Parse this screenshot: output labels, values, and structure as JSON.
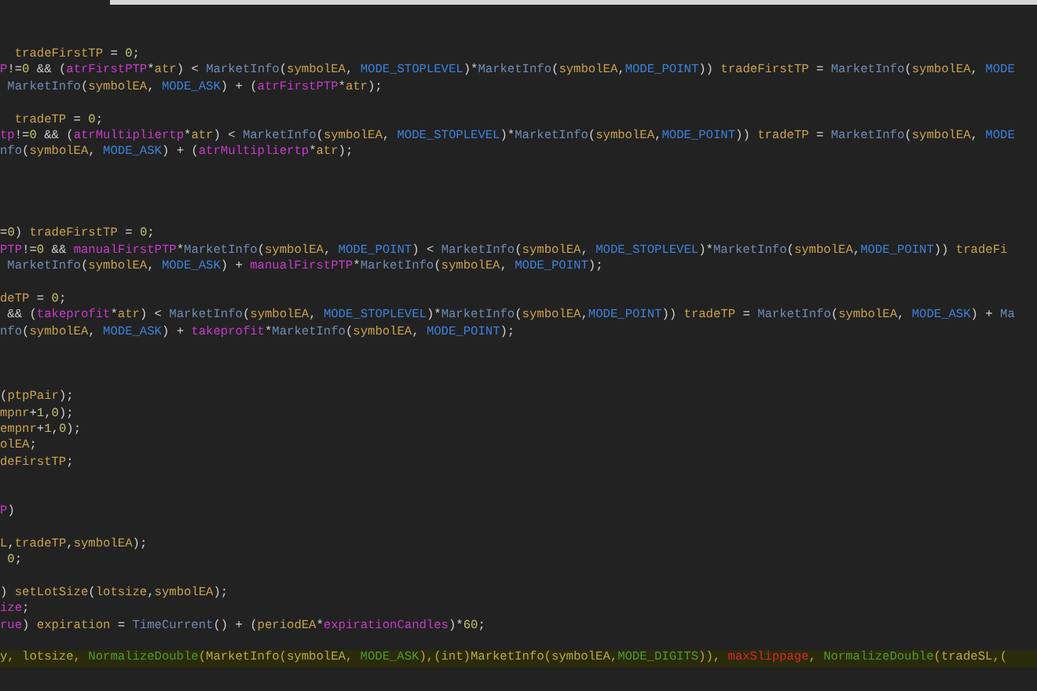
{
  "editor": {
    "lines": [
      {
        "kind": "code",
        "segments": [
          {
            "kind": "var",
            "text": "  tradeFirstTP"
          },
          {
            "kind": "op",
            "text": " = "
          },
          {
            "kind": "num",
            "text": "0"
          },
          {
            "kind": "op",
            "text": ";"
          }
        ]
      },
      {
        "kind": "code",
        "segments": [
          {
            "kind": "input",
            "text": "P"
          },
          {
            "kind": "op",
            "text": "!="
          },
          {
            "kind": "num",
            "text": "0"
          },
          {
            "kind": "op",
            "text": " && ("
          },
          {
            "kind": "input",
            "text": "atrFirstPTP"
          },
          {
            "kind": "op",
            "text": "*"
          },
          {
            "kind": "var",
            "text": "atr"
          },
          {
            "kind": "op",
            "text": ") < "
          },
          {
            "kind": "func",
            "text": "MarketInfo"
          },
          {
            "kind": "op",
            "text": "("
          },
          {
            "kind": "var",
            "text": "symbolEA"
          },
          {
            "kind": "op",
            "text": ", "
          },
          {
            "kind": "const",
            "text": "MODE_STOPLEVEL"
          },
          {
            "kind": "op",
            "text": ")*"
          },
          {
            "kind": "func",
            "text": "MarketInfo"
          },
          {
            "kind": "op",
            "text": "("
          },
          {
            "kind": "var",
            "text": "symbolEA"
          },
          {
            "kind": "op",
            "text": ","
          },
          {
            "kind": "const",
            "text": "MODE_POINT"
          },
          {
            "kind": "op",
            "text": ")) "
          },
          {
            "kind": "var",
            "text": "tradeFirstTP"
          },
          {
            "kind": "op",
            "text": " = "
          },
          {
            "kind": "func",
            "text": "MarketInfo"
          },
          {
            "kind": "op",
            "text": "("
          },
          {
            "kind": "var",
            "text": "symbolEA"
          },
          {
            "kind": "op",
            "text": ", "
          },
          {
            "kind": "const",
            "text": "MODE"
          }
        ]
      },
      {
        "kind": "code",
        "segments": [
          {
            "kind": "func",
            "text": " MarketInfo"
          },
          {
            "kind": "op",
            "text": "("
          },
          {
            "kind": "var",
            "text": "symbolEA"
          },
          {
            "kind": "op",
            "text": ", "
          },
          {
            "kind": "const",
            "text": "MODE_ASK"
          },
          {
            "kind": "op",
            "text": ") + ("
          },
          {
            "kind": "input",
            "text": "atrFirstPTP"
          },
          {
            "kind": "op",
            "text": "*"
          },
          {
            "kind": "var",
            "text": "atr"
          },
          {
            "kind": "op",
            "text": ");"
          }
        ]
      },
      {
        "kind": "blank"
      },
      {
        "kind": "code",
        "segments": [
          {
            "kind": "var",
            "text": "  tradeTP"
          },
          {
            "kind": "op",
            "text": " = "
          },
          {
            "kind": "num",
            "text": "0"
          },
          {
            "kind": "op",
            "text": ";"
          }
        ]
      },
      {
        "kind": "code",
        "segments": [
          {
            "kind": "input",
            "text": "tp"
          },
          {
            "kind": "op",
            "text": "!="
          },
          {
            "kind": "num",
            "text": "0"
          },
          {
            "kind": "op",
            "text": " && ("
          },
          {
            "kind": "input",
            "text": "atrMultipliertp"
          },
          {
            "kind": "op",
            "text": "*"
          },
          {
            "kind": "var",
            "text": "atr"
          },
          {
            "kind": "op",
            "text": ") < "
          },
          {
            "kind": "func",
            "text": "MarketInfo"
          },
          {
            "kind": "op",
            "text": "("
          },
          {
            "kind": "var",
            "text": "symbolEA"
          },
          {
            "kind": "op",
            "text": ", "
          },
          {
            "kind": "const",
            "text": "MODE_STOPLEVEL"
          },
          {
            "kind": "op",
            "text": ")*"
          },
          {
            "kind": "func",
            "text": "MarketInfo"
          },
          {
            "kind": "op",
            "text": "("
          },
          {
            "kind": "var",
            "text": "symbolEA"
          },
          {
            "kind": "op",
            "text": ","
          },
          {
            "kind": "const",
            "text": "MODE_POINT"
          },
          {
            "kind": "op",
            "text": ")) "
          },
          {
            "kind": "var",
            "text": "tradeTP"
          },
          {
            "kind": "op",
            "text": " = "
          },
          {
            "kind": "func",
            "text": "MarketInfo"
          },
          {
            "kind": "op",
            "text": "("
          },
          {
            "kind": "var",
            "text": "symbolEA"
          },
          {
            "kind": "op",
            "text": ", "
          },
          {
            "kind": "const",
            "text": "MODE"
          }
        ]
      },
      {
        "kind": "code",
        "segments": [
          {
            "kind": "func",
            "text": "nfo"
          },
          {
            "kind": "op",
            "text": "("
          },
          {
            "kind": "var",
            "text": "symbolEA"
          },
          {
            "kind": "op",
            "text": ", "
          },
          {
            "kind": "const",
            "text": "MODE_ASK"
          },
          {
            "kind": "op",
            "text": ") + ("
          },
          {
            "kind": "input",
            "text": "atrMultipliertp"
          },
          {
            "kind": "op",
            "text": "*"
          },
          {
            "kind": "var",
            "text": "atr"
          },
          {
            "kind": "op",
            "text": ");"
          }
        ]
      },
      {
        "kind": "blank"
      },
      {
        "kind": "blank"
      },
      {
        "kind": "blank"
      },
      {
        "kind": "blank"
      },
      {
        "kind": "code",
        "segments": [
          {
            "kind": "op",
            "text": "="
          },
          {
            "kind": "num",
            "text": "0"
          },
          {
            "kind": "op",
            "text": ") "
          },
          {
            "kind": "var",
            "text": "tradeFirstTP"
          },
          {
            "kind": "op",
            "text": " = "
          },
          {
            "kind": "num",
            "text": "0"
          },
          {
            "kind": "op",
            "text": ";"
          }
        ]
      },
      {
        "kind": "code",
        "segments": [
          {
            "kind": "input",
            "text": "PTP"
          },
          {
            "kind": "op",
            "text": "!="
          },
          {
            "kind": "num",
            "text": "0"
          },
          {
            "kind": "op",
            "text": " && "
          },
          {
            "kind": "input",
            "text": "manualFirstPTP"
          },
          {
            "kind": "op",
            "text": "*"
          },
          {
            "kind": "func",
            "text": "MarketInfo"
          },
          {
            "kind": "op",
            "text": "("
          },
          {
            "kind": "var",
            "text": "symbolEA"
          },
          {
            "kind": "op",
            "text": ", "
          },
          {
            "kind": "const",
            "text": "MODE_POINT"
          },
          {
            "kind": "op",
            "text": ") < "
          },
          {
            "kind": "func",
            "text": "MarketInfo"
          },
          {
            "kind": "op",
            "text": "("
          },
          {
            "kind": "var",
            "text": "symbolEA"
          },
          {
            "kind": "op",
            "text": ", "
          },
          {
            "kind": "const",
            "text": "MODE_STOPLEVEL"
          },
          {
            "kind": "op",
            "text": ")*"
          },
          {
            "kind": "func",
            "text": "MarketInfo"
          },
          {
            "kind": "op",
            "text": "("
          },
          {
            "kind": "var",
            "text": "symbolEA"
          },
          {
            "kind": "op",
            "text": ","
          },
          {
            "kind": "const",
            "text": "MODE_POINT"
          },
          {
            "kind": "op",
            "text": ")) "
          },
          {
            "kind": "var",
            "text": "tradeFi"
          }
        ]
      },
      {
        "kind": "code",
        "segments": [
          {
            "kind": "func",
            "text": " MarketInfo"
          },
          {
            "kind": "op",
            "text": "("
          },
          {
            "kind": "var",
            "text": "symbolEA"
          },
          {
            "kind": "op",
            "text": ", "
          },
          {
            "kind": "const",
            "text": "MODE_ASK"
          },
          {
            "kind": "op",
            "text": ") + "
          },
          {
            "kind": "input",
            "text": "manualFirstPTP"
          },
          {
            "kind": "op",
            "text": "*"
          },
          {
            "kind": "func",
            "text": "MarketInfo"
          },
          {
            "kind": "op",
            "text": "("
          },
          {
            "kind": "var",
            "text": "symbolEA"
          },
          {
            "kind": "op",
            "text": ", "
          },
          {
            "kind": "const",
            "text": "MODE_POINT"
          },
          {
            "kind": "op",
            "text": ");"
          }
        ]
      },
      {
        "kind": "blank"
      },
      {
        "kind": "code",
        "segments": [
          {
            "kind": "var",
            "text": "deTP"
          },
          {
            "kind": "op",
            "text": " = "
          },
          {
            "kind": "num",
            "text": "0"
          },
          {
            "kind": "op",
            "text": ";"
          }
        ]
      },
      {
        "kind": "code",
        "segments": [
          {
            "kind": "op",
            "text": " && ("
          },
          {
            "kind": "input",
            "text": "takeprofit"
          },
          {
            "kind": "op",
            "text": "*"
          },
          {
            "kind": "var",
            "text": "atr"
          },
          {
            "kind": "op",
            "text": ") < "
          },
          {
            "kind": "func",
            "text": "MarketInfo"
          },
          {
            "kind": "op",
            "text": "("
          },
          {
            "kind": "var",
            "text": "symbolEA"
          },
          {
            "kind": "op",
            "text": ", "
          },
          {
            "kind": "const",
            "text": "MODE_STOPLEVEL"
          },
          {
            "kind": "op",
            "text": ")*"
          },
          {
            "kind": "func",
            "text": "MarketInfo"
          },
          {
            "kind": "op",
            "text": "("
          },
          {
            "kind": "var",
            "text": "symbolEA"
          },
          {
            "kind": "op",
            "text": ","
          },
          {
            "kind": "const",
            "text": "MODE_POINT"
          },
          {
            "kind": "op",
            "text": ")) "
          },
          {
            "kind": "var",
            "text": "tradeTP"
          },
          {
            "kind": "op",
            "text": " = "
          },
          {
            "kind": "func",
            "text": "MarketInfo"
          },
          {
            "kind": "op",
            "text": "("
          },
          {
            "kind": "var",
            "text": "symbolEA"
          },
          {
            "kind": "op",
            "text": ", "
          },
          {
            "kind": "const",
            "text": "MODE_ASK"
          },
          {
            "kind": "op",
            "text": ") + "
          },
          {
            "kind": "func",
            "text": "Ma"
          }
        ]
      },
      {
        "kind": "code",
        "segments": [
          {
            "kind": "func",
            "text": "nfo"
          },
          {
            "kind": "op",
            "text": "("
          },
          {
            "kind": "var",
            "text": "symbolEA"
          },
          {
            "kind": "op",
            "text": ", "
          },
          {
            "kind": "const",
            "text": "MODE_ASK"
          },
          {
            "kind": "op",
            "text": ") + "
          },
          {
            "kind": "input",
            "text": "takeprofit"
          },
          {
            "kind": "op",
            "text": "*"
          },
          {
            "kind": "func",
            "text": "MarketInfo"
          },
          {
            "kind": "op",
            "text": "("
          },
          {
            "kind": "var",
            "text": "symbolEA"
          },
          {
            "kind": "op",
            "text": ", "
          },
          {
            "kind": "const",
            "text": "MODE_POINT"
          },
          {
            "kind": "op",
            "text": ");"
          }
        ]
      },
      {
        "kind": "blank"
      },
      {
        "kind": "blank"
      },
      {
        "kind": "blank"
      },
      {
        "kind": "code",
        "segments": [
          {
            "kind": "op",
            "text": "("
          },
          {
            "kind": "var",
            "text": "ptpPair"
          },
          {
            "kind": "op",
            "text": ");"
          }
        ]
      },
      {
        "kind": "code",
        "segments": [
          {
            "kind": "var",
            "text": "mpnr"
          },
          {
            "kind": "op",
            "text": "+"
          },
          {
            "kind": "num",
            "text": "1"
          },
          {
            "kind": "op",
            "text": ","
          },
          {
            "kind": "num",
            "text": "0"
          },
          {
            "kind": "op",
            "text": ");"
          }
        ]
      },
      {
        "kind": "code",
        "segments": [
          {
            "kind": "var",
            "text": "empnr"
          },
          {
            "kind": "op",
            "text": "+"
          },
          {
            "kind": "num",
            "text": "1"
          },
          {
            "kind": "op",
            "text": ","
          },
          {
            "kind": "num",
            "text": "0"
          },
          {
            "kind": "op",
            "text": ");"
          }
        ]
      },
      {
        "kind": "code",
        "segments": [
          {
            "kind": "var",
            "text": "olEA"
          },
          {
            "kind": "op",
            "text": ";"
          }
        ]
      },
      {
        "kind": "code",
        "segments": [
          {
            "kind": "var",
            "text": "deFirstTP"
          },
          {
            "kind": "op",
            "text": ";"
          }
        ]
      },
      {
        "kind": "blank"
      },
      {
        "kind": "blank"
      },
      {
        "kind": "code",
        "segments": [
          {
            "kind": "input",
            "text": "P"
          },
          {
            "kind": "op",
            "text": ")"
          }
        ]
      },
      {
        "kind": "blank"
      },
      {
        "kind": "code",
        "segments": [
          {
            "kind": "var",
            "text": "L"
          },
          {
            "kind": "op",
            "text": ","
          },
          {
            "kind": "var",
            "text": "tradeTP"
          },
          {
            "kind": "op",
            "text": ","
          },
          {
            "kind": "var",
            "text": "symbolEA"
          },
          {
            "kind": "op",
            "text": ");"
          }
        ]
      },
      {
        "kind": "code",
        "segments": [
          {
            "kind": "num",
            "text": " 0"
          },
          {
            "kind": "op",
            "text": ";"
          }
        ]
      },
      {
        "kind": "blank"
      },
      {
        "kind": "code",
        "segments": [
          {
            "kind": "op",
            "text": ") "
          },
          {
            "kind": "var",
            "text": "setLotSize"
          },
          {
            "kind": "op",
            "text": "("
          },
          {
            "kind": "var",
            "text": "lotsize"
          },
          {
            "kind": "op",
            "text": ","
          },
          {
            "kind": "var",
            "text": "symbolEA"
          },
          {
            "kind": "op",
            "text": ");"
          }
        ]
      },
      {
        "kind": "code",
        "segments": [
          {
            "kind": "input",
            "text": "ize"
          },
          {
            "kind": "op",
            "text": ";"
          }
        ]
      },
      {
        "kind": "code",
        "segments": [
          {
            "kind": "input",
            "text": "rue"
          },
          {
            "kind": "op",
            "text": ") "
          },
          {
            "kind": "var",
            "text": "expiration"
          },
          {
            "kind": "op",
            "text": " = "
          },
          {
            "kind": "func",
            "text": "TimeCurrent"
          },
          {
            "kind": "op",
            "text": "() + ("
          },
          {
            "kind": "var",
            "text": "periodEA"
          },
          {
            "kind": "op",
            "text": "*"
          },
          {
            "kind": "input",
            "text": "expirationCandles"
          },
          {
            "kind": "op",
            "text": ")*"
          },
          {
            "kind": "num",
            "text": "60"
          },
          {
            "kind": "op",
            "text": ";"
          }
        ]
      },
      {
        "kind": "blank"
      },
      {
        "kind": "code",
        "highlighted": true,
        "segments": [
          {
            "kind": "text",
            "text": "y, lotsize, "
          },
          {
            "kind": "builtin",
            "text": "NormalizeDouble"
          },
          {
            "kind": "text",
            "text": "(MarketInfo(symbolEA, "
          },
          {
            "kind": "builtin",
            "text": "MODE_ASK"
          },
          {
            "kind": "text",
            "text": "),(int)MarketInfo(symbolEA,"
          },
          {
            "kind": "builtin",
            "text": "MODE_DIGITS"
          },
          {
            "kind": "text",
            "text": ")), "
          },
          {
            "kind": "error",
            "text": "maxSlippage"
          },
          {
            "kind": "text",
            "text": ", "
          },
          {
            "kind": "builtin",
            "text": "NormalizeDouble"
          },
          {
            "kind": "text",
            "text": "(tradeSL,("
          }
        ]
      }
    ]
  }
}
